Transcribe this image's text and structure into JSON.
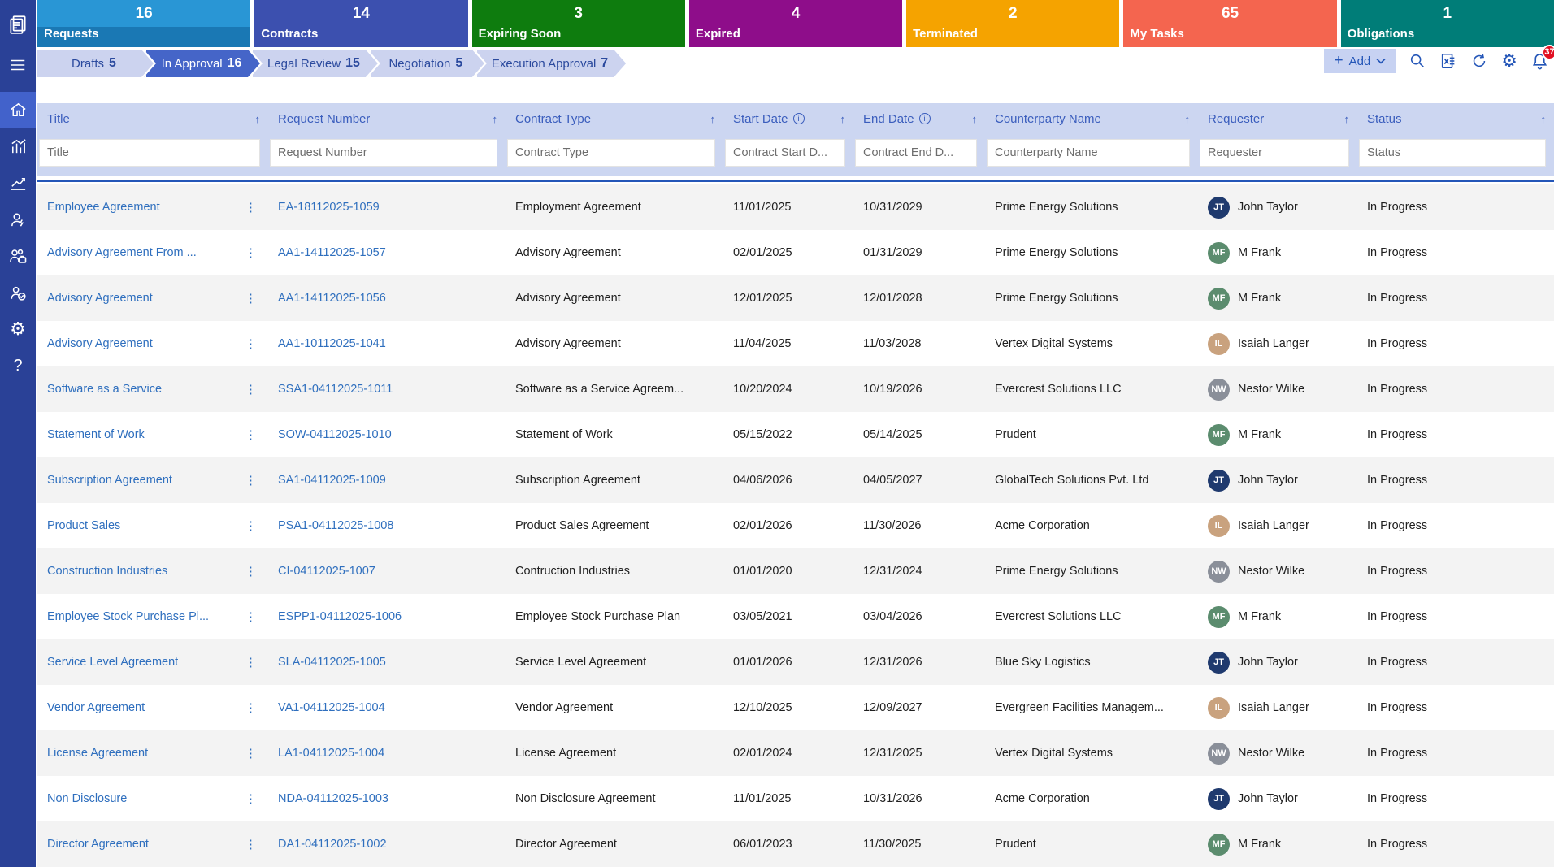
{
  "sidebar": {
    "items": [
      "app-logo",
      "menu-icon",
      "home-icon",
      "bar-chart-icon",
      "line-chart-icon",
      "user-actions-icon",
      "team-briefcase-icon",
      "team-sync-icon",
      "settings-icon",
      "help-icon"
    ]
  },
  "kpi_cards": [
    {
      "label": "Requests",
      "value": "16",
      "color_top": "#2996d5",
      "color_bottom": "#1a78b4"
    },
    {
      "label": "Contracts",
      "value": "14",
      "color_top": "#3c50af",
      "color_bottom": "#3c50af"
    },
    {
      "label": "Expiring Soon",
      "value": "3",
      "color_top": "#0e7c0e",
      "color_bottom": "#0e7c0e"
    },
    {
      "label": "Expired",
      "value": "4",
      "color_top": "#8e0d8a",
      "color_bottom": "#8e0d8a"
    },
    {
      "label": "Terminated",
      "value": "2",
      "color_top": "#f5a300",
      "color_bottom": "#f5a300"
    },
    {
      "label": "My Tasks",
      "value": "65",
      "color_top": "#f4654f",
      "color_bottom": "#f4654f"
    },
    {
      "label": "Obligations",
      "value": "1",
      "color_top": "#007d78",
      "color_bottom": "#007d78"
    }
  ],
  "stages": [
    {
      "label": "Drafts",
      "count": "5",
      "active": false
    },
    {
      "label": "In Approval",
      "count": "16",
      "active": true
    },
    {
      "label": "Legal Review",
      "count": "15",
      "active": false
    },
    {
      "label": "Negotiation",
      "count": "5",
      "active": false
    },
    {
      "label": "Execution Approval",
      "count": "7",
      "active": false
    }
  ],
  "toolbar": {
    "add_label": "Add",
    "icons": [
      "search-icon",
      "excel-export-icon",
      "refresh-icon",
      "settings-icon",
      "notifications-icon"
    ],
    "notification_count": "37"
  },
  "table": {
    "columns": [
      {
        "label": "Title",
        "placeholder": "Title",
        "info": false
      },
      {
        "label": "Request Number",
        "placeholder": "Request Number",
        "info": false
      },
      {
        "label": "Contract Type",
        "placeholder": "Contract Type",
        "info": false
      },
      {
        "label": "Start Date",
        "placeholder": "Contract Start D...",
        "info": true
      },
      {
        "label": "End Date",
        "placeholder": "Contract End D...",
        "info": true
      },
      {
        "label": "Counterparty Name",
        "placeholder": "Counterparty Name",
        "info": false
      },
      {
        "label": "Requester",
        "placeholder": "Requester",
        "info": false
      },
      {
        "label": "Status",
        "placeholder": "Status",
        "info": false
      }
    ],
    "rows": [
      {
        "title": "Employee Agreement",
        "request_number": "EA-18112025-1059",
        "contract_type": "Employment Agreement",
        "start_date": "11/01/2025",
        "end_date": "10/31/2029",
        "counterparty": "Prime Energy Solutions",
        "requester": "John Taylor",
        "initials": "JT",
        "avatar_color": "#1f3a6e",
        "status": "In Progress"
      },
      {
        "title": "Advisory Agreement From ...",
        "request_number": "AA1-14112025-1057",
        "contract_type": "Advisory Agreement",
        "start_date": "02/01/2025",
        "end_date": "01/31/2029",
        "counterparty": "Prime Energy Solutions",
        "requester": "M Frank",
        "initials": "MF",
        "avatar_color": "#5b8c6e",
        "status": "In Progress"
      },
      {
        "title": "Advisory Agreement",
        "request_number": "AA1-14112025-1056",
        "contract_type": "Advisory Agreement",
        "start_date": "12/01/2025",
        "end_date": "12/01/2028",
        "counterparty": "Prime Energy Solutions",
        "requester": "M Frank",
        "initials": "MF",
        "avatar_color": "#5b8c6e",
        "status": "In Progress"
      },
      {
        "title": "Advisory Agreement",
        "request_number": "AA1-10112025-1041",
        "contract_type": "Advisory Agreement",
        "start_date": "11/04/2025",
        "end_date": "11/03/2028",
        "counterparty": "Vertex Digital Systems",
        "requester": "Isaiah Langer",
        "initials": "IL",
        "avatar_color": "#c9a27e",
        "status": "In Progress"
      },
      {
        "title": "Software as a Service",
        "request_number": "SSA1-04112025-1011",
        "contract_type": "Software as a Service Agreem...",
        "start_date": "10/20/2024",
        "end_date": "10/19/2026",
        "counterparty": "Evercrest Solutions LLC",
        "requester": "Nestor Wilke",
        "initials": "NW",
        "avatar_color": "#8a8f99",
        "status": "In Progress"
      },
      {
        "title": "Statement of Work",
        "request_number": "SOW-04112025-1010",
        "contract_type": "Statement of Work",
        "start_date": "05/15/2022",
        "end_date": "05/14/2025",
        "counterparty": "Prudent",
        "requester": "M Frank",
        "initials": "MF",
        "avatar_color": "#5b8c6e",
        "status": "In Progress"
      },
      {
        "title": "Subscription Agreement",
        "request_number": "SA1-04112025-1009",
        "contract_type": "Subscription Agreement",
        "start_date": "04/06/2026",
        "end_date": "04/05/2027",
        "counterparty": "GlobalTech Solutions Pvt. Ltd",
        "requester": "John Taylor",
        "initials": "JT",
        "avatar_color": "#1f3a6e",
        "status": "In Progress"
      },
      {
        "title": "Product Sales",
        "request_number": "PSA1-04112025-1008",
        "contract_type": "Product Sales Agreement",
        "start_date": "02/01/2026",
        "end_date": "11/30/2026",
        "counterparty": "Acme Corporation",
        "requester": "Isaiah Langer",
        "initials": "IL",
        "avatar_color": "#c9a27e",
        "status": "In Progress"
      },
      {
        "title": "Construction Industries",
        "request_number": "CI-04112025-1007",
        "contract_type": "Contruction Industries",
        "start_date": "01/01/2020",
        "end_date": "12/31/2024",
        "counterparty": "Prime Energy Solutions",
        "requester": "Nestor Wilke",
        "initials": "NW",
        "avatar_color": "#8a8f99",
        "status": "In Progress"
      },
      {
        "title": "Employee Stock Purchase Pl...",
        "request_number": "ESPP1-04112025-1006",
        "contract_type": "Employee Stock Purchase Plan",
        "start_date": "03/05/2021",
        "end_date": "03/04/2026",
        "counterparty": "Evercrest Solutions LLC",
        "requester": "M Frank",
        "initials": "MF",
        "avatar_color": "#5b8c6e",
        "status": "In Progress"
      },
      {
        "title": "Service Level Agreement",
        "request_number": "SLA-04112025-1005",
        "contract_type": "Service Level Agreement",
        "start_date": "01/01/2026",
        "end_date": "12/31/2026",
        "counterparty": "Blue Sky Logistics",
        "requester": "John Taylor",
        "initials": "JT",
        "avatar_color": "#1f3a6e",
        "status": "In Progress"
      },
      {
        "title": "Vendor Agreement",
        "request_number": "VA1-04112025-1004",
        "contract_type": "Vendor Agreement",
        "start_date": "12/10/2025",
        "end_date": "12/09/2027",
        "counterparty": "Evergreen Facilities Managem...",
        "requester": "Isaiah Langer",
        "initials": "IL",
        "avatar_color": "#c9a27e",
        "status": "In Progress"
      },
      {
        "title": "License Agreement",
        "request_number": "LA1-04112025-1004",
        "contract_type": "License Agreement",
        "start_date": "02/01/2024",
        "end_date": "12/31/2025",
        "counterparty": "Vertex Digital Systems",
        "requester": "Nestor Wilke",
        "initials": "NW",
        "avatar_color": "#8a8f99",
        "status": "In Progress"
      },
      {
        "title": "Non Disclosure",
        "request_number": "NDA-04112025-1003",
        "contract_type": "Non Disclosure Agreement",
        "start_date": "11/01/2025",
        "end_date": "10/31/2026",
        "counterparty": "Acme Corporation",
        "requester": "John Taylor",
        "initials": "JT",
        "avatar_color": "#1f3a6e",
        "status": "In Progress"
      },
      {
        "title": "Director Agreement",
        "request_number": "DA1-04112025-1002",
        "contract_type": "Director Agreement",
        "start_date": "06/01/2023",
        "end_date": "11/30/2025",
        "counterparty": "Prudent",
        "requester": "M Frank",
        "initials": "MF",
        "avatar_color": "#5b8c6e",
        "status": "In Progress"
      }
    ]
  }
}
